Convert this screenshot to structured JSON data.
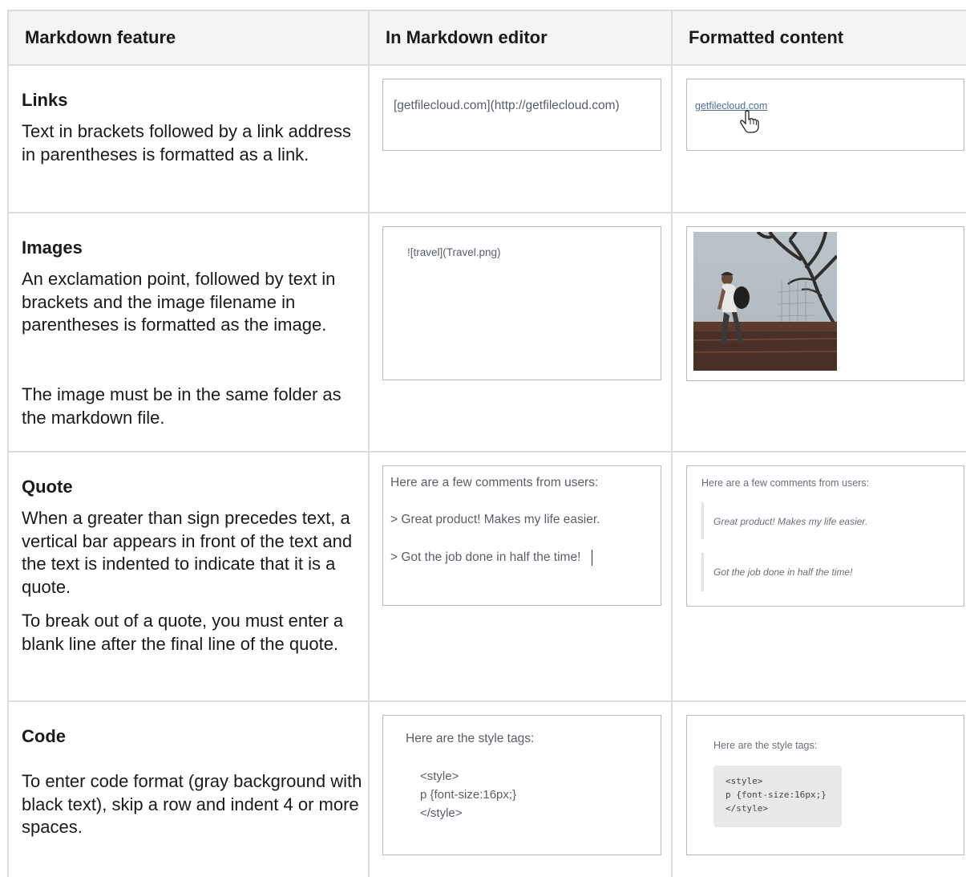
{
  "table": {
    "headers": [
      "Markdown feature",
      "In Markdown editor",
      "Formatted content"
    ],
    "rows": {
      "links": {
        "title": "Links",
        "description": "Text in brackets followed by a link address in parentheses is formatted as a link.",
        "editor": "[getfilecloud.com](http://getfilecloud.com)",
        "formatted_link": "getfilecloud.com"
      },
      "images": {
        "title": "Images",
        "description": "An exclamation point, followed by text in brackets and the image filename in parentheses is formatted as the image.",
        "note": "The image must be in the same folder as the markdown file.",
        "editor": "![travel](Travel.png)",
        "image_label": "travel"
      },
      "quote": {
        "title": "Quote",
        "description": "When a greater than sign precedes text, a vertical bar appears in front of the text and the text is indented to indicate that it is a quote.",
        "note": "To break out of a quote, you must enter a blank line after the final line of the quote.",
        "editor_lines": [
          "Here are a few comments from users:",
          "> Great product! Makes my life easier.",
          "> Got the job done in half the time!"
        ],
        "formatted_intro": "Here are a few comments from users:",
        "formatted_quotes": [
          "Great product! Makes my life easier.",
          "Got the job done in half the time!"
        ]
      },
      "code": {
        "title": "Code",
        "description": "To enter code format (gray background with black text), skip a row and indent 4 or more spaces.",
        "editor_intro": "Here are the style tags:",
        "editor_code": [
          "<style>",
          "p {font-size:16px;}",
          "</style>"
        ],
        "formatted_intro": "Here are the style tags:",
        "formatted_code": [
          "<style>",
          "p {font-size:16px;}",
          "</style>"
        ]
      }
    }
  },
  "colors": {
    "border": "#dcdcdc",
    "header_bg": "#f4f4f4",
    "link": "#4a6fa5",
    "code_bg": "#e8e9eb"
  },
  "icons": {
    "cursor": "hand-pointer-icon"
  }
}
